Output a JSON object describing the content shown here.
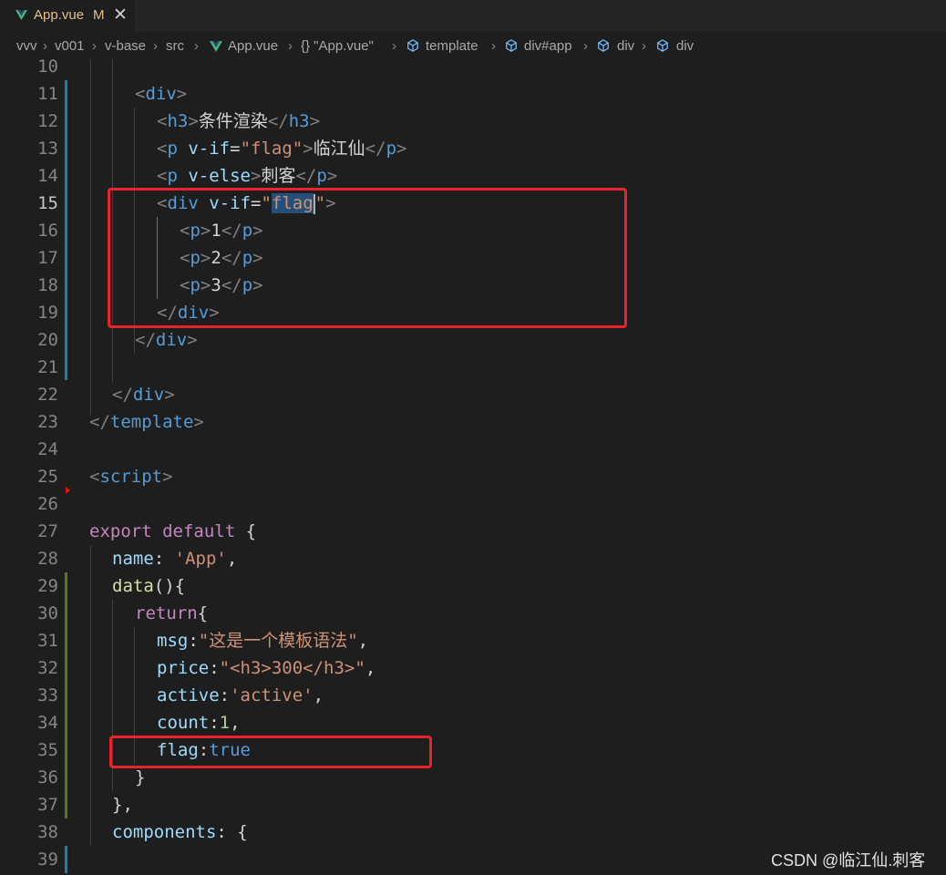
{
  "tab": {
    "filename": "App.vue",
    "status": "M",
    "close_glyph": "✕",
    "icon": "vue-icon"
  },
  "breadcrumb": {
    "items": [
      "vvv",
      "v001",
      "v-base",
      "src",
      "App.vue",
      "{} \"App.vue\"",
      "template",
      "div#app",
      "div",
      "div"
    ]
  },
  "editor": {
    "active_line": "15",
    "lines": [
      {
        "n": "10"
      },
      {
        "n": "11",
        "c": [
          {
            "t": "<",
            "k": "br"
          },
          {
            "t": "div",
            "k": "tag"
          },
          {
            "t": ">",
            "k": "br"
          }
        ]
      },
      {
        "n": "12",
        "c": [
          {
            "t": "<",
            "k": "br"
          },
          {
            "t": "h3",
            "k": "tag"
          },
          {
            "t": ">",
            "k": "br"
          },
          {
            "t": "条件渲染",
            "k": "txt"
          },
          {
            "t": "</",
            "k": "br"
          },
          {
            "t": "h3",
            "k": "tag"
          },
          {
            "t": ">",
            "k": "br"
          }
        ]
      },
      {
        "n": "13",
        "c": [
          {
            "t": "<",
            "k": "br"
          },
          {
            "t": "p ",
            "k": "tag"
          },
          {
            "t": "v-if",
            "k": "attr"
          },
          {
            "t": "=",
            "k": "txt"
          },
          {
            "t": "\"flag\"",
            "k": "str"
          },
          {
            "t": ">",
            "k": "br"
          },
          {
            "t": "临江仙",
            "k": "txt"
          },
          {
            "t": "</",
            "k": "br"
          },
          {
            "t": "p",
            "k": "tag"
          },
          {
            "t": ">",
            "k": "br"
          }
        ]
      },
      {
        "n": "14",
        "c": [
          {
            "t": "<",
            "k": "br"
          },
          {
            "t": "p ",
            "k": "tag"
          },
          {
            "t": "v-else",
            "k": "attr"
          },
          {
            "t": ">",
            "k": "br"
          },
          {
            "t": "刺客",
            "k": "txt"
          },
          {
            "t": "</",
            "k": "br"
          },
          {
            "t": "p",
            "k": "tag"
          },
          {
            "t": ">",
            "k": "br"
          }
        ]
      },
      {
        "n": "15",
        "c": [
          {
            "t": "<",
            "k": "br"
          },
          {
            "t": "div ",
            "k": "tag"
          },
          {
            "t": "v-if",
            "k": "attr"
          },
          {
            "t": "=",
            "k": "txt"
          },
          {
            "t": "\"",
            "k": "str"
          },
          {
            "t": "flag",
            "k": "str sel"
          },
          {
            "t": "\"",
            "k": "str"
          },
          {
            "t": ">",
            "k": "br"
          }
        ]
      },
      {
        "n": "16",
        "c": [
          {
            "t": "<",
            "k": "br"
          },
          {
            "t": "p",
            "k": "tag"
          },
          {
            "t": ">",
            "k": "br"
          },
          {
            "t": "1",
            "k": "txt"
          },
          {
            "t": "</",
            "k": "br"
          },
          {
            "t": "p",
            "k": "tag"
          },
          {
            "t": ">",
            "k": "br"
          }
        ]
      },
      {
        "n": "17",
        "c": [
          {
            "t": "<",
            "k": "br"
          },
          {
            "t": "p",
            "k": "tag"
          },
          {
            "t": ">",
            "k": "br"
          },
          {
            "t": "2",
            "k": "txt"
          },
          {
            "t": "</",
            "k": "br"
          },
          {
            "t": "p",
            "k": "tag"
          },
          {
            "t": ">",
            "k": "br"
          }
        ]
      },
      {
        "n": "18",
        "c": [
          {
            "t": "<",
            "k": "br"
          },
          {
            "t": "p",
            "k": "tag"
          },
          {
            "t": ">",
            "k": "br"
          },
          {
            "t": "3",
            "k": "txt"
          },
          {
            "t": "</",
            "k": "br"
          },
          {
            "t": "p",
            "k": "tag"
          },
          {
            "t": ">",
            "k": "br"
          }
        ]
      },
      {
        "n": "19",
        "c": [
          {
            "t": "</",
            "k": "br"
          },
          {
            "t": "div",
            "k": "tag"
          },
          {
            "t": ">",
            "k": "br"
          }
        ]
      },
      {
        "n": "20",
        "c": [
          {
            "t": "</",
            "k": "br"
          },
          {
            "t": "div",
            "k": "tag"
          },
          {
            "t": ">",
            "k": "br"
          }
        ]
      },
      {
        "n": "21"
      },
      {
        "n": "22",
        "c": [
          {
            "t": "</",
            "k": "br"
          },
          {
            "t": "div",
            "k": "tag"
          },
          {
            "t": ">",
            "k": "br"
          }
        ]
      },
      {
        "n": "23",
        "c": [
          {
            "t": "</",
            "k": "br"
          },
          {
            "t": "template",
            "k": "tag"
          },
          {
            "t": ">",
            "k": "br"
          }
        ]
      },
      {
        "n": "24"
      },
      {
        "n": "25",
        "c": [
          {
            "t": "<",
            "k": "br"
          },
          {
            "t": "script",
            "k": "tag"
          },
          {
            "t": ">",
            "k": "br"
          }
        ]
      },
      {
        "n": "26"
      },
      {
        "n": "27",
        "c": [
          {
            "t": "export ",
            "k": "kw"
          },
          {
            "t": "default ",
            "k": "kw"
          },
          {
            "t": "{",
            "k": "txt"
          }
        ]
      },
      {
        "n": "28",
        "c": [
          {
            "t": "name",
            "k": "prop"
          },
          {
            "t": ": ",
            "k": "txt"
          },
          {
            "t": "'App'",
            "k": "str"
          },
          {
            "t": ",",
            "k": "txt"
          }
        ]
      },
      {
        "n": "29",
        "c": [
          {
            "t": "data",
            "k": "fn"
          },
          {
            "t": "(){",
            "k": "txt"
          }
        ]
      },
      {
        "n": "30",
        "c": [
          {
            "t": "return",
            "k": "kw"
          },
          {
            "t": "{",
            "k": "txt"
          }
        ]
      },
      {
        "n": "31",
        "c": [
          {
            "t": "msg",
            "k": "prop"
          },
          {
            "t": ":",
            "k": "txt"
          },
          {
            "t": "\"这是一个模板语法\"",
            "k": "str"
          },
          {
            "t": ",",
            "k": "txt"
          }
        ]
      },
      {
        "n": "32",
        "c": [
          {
            "t": "price",
            "k": "prop"
          },
          {
            "t": ":",
            "k": "txt"
          },
          {
            "t": "\"<h3>300</h3>\"",
            "k": "str"
          },
          {
            "t": ",",
            "k": "txt"
          }
        ]
      },
      {
        "n": "33",
        "c": [
          {
            "t": "active",
            "k": "prop"
          },
          {
            "t": ":",
            "k": "txt"
          },
          {
            "t": "'active'",
            "k": "str"
          },
          {
            "t": ",",
            "k": "txt"
          }
        ]
      },
      {
        "n": "34",
        "c": [
          {
            "t": "count",
            "k": "prop"
          },
          {
            "t": ":",
            "k": "txt"
          },
          {
            "t": "1",
            "k": "num"
          },
          {
            "t": ",",
            "k": "txt"
          }
        ]
      },
      {
        "n": "35",
        "c": [
          {
            "t": "flag",
            "k": "prop"
          },
          {
            "t": ":",
            "k": "txt"
          },
          {
            "t": "true",
            "k": "bool"
          }
        ]
      },
      {
        "n": "36",
        "c": [
          {
            "t": "}",
            "k": "txt"
          }
        ]
      },
      {
        "n": "37",
        "c": [
          {
            "t": "},",
            "k": "txt"
          }
        ]
      },
      {
        "n": "38",
        "c": [
          {
            "t": "components",
            "k": "prop"
          },
          {
            "t": ": {",
            "k": "txt"
          }
        ]
      },
      {
        "n": "39"
      }
    ]
  },
  "watermark": "CSDN @临江仙.刺客"
}
